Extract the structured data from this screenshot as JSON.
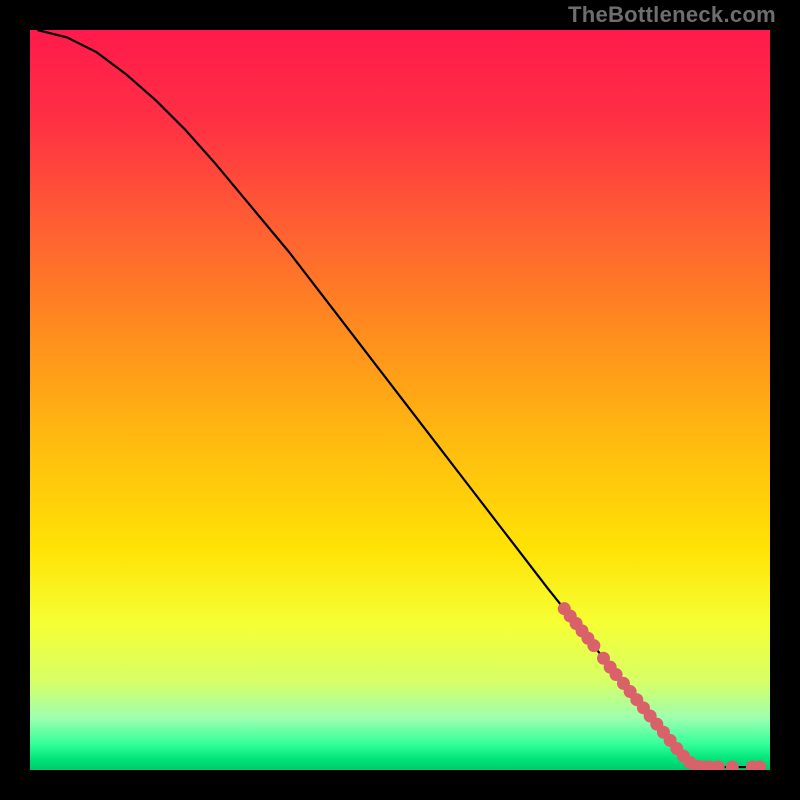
{
  "watermark": "TheBottleneck.com",
  "chart_data": {
    "type": "line",
    "title": "",
    "xlabel": "",
    "ylabel": "",
    "xlim": [
      0,
      100
    ],
    "ylim": [
      0,
      100
    ],
    "grid": false,
    "gradient_stops": [
      {
        "offset": 0.0,
        "color": "#ff1a4b"
      },
      {
        "offset": 0.12,
        "color": "#ff2f44"
      },
      {
        "offset": 0.25,
        "color": "#ff5a35"
      },
      {
        "offset": 0.4,
        "color": "#ff8a1f"
      },
      {
        "offset": 0.55,
        "color": "#ffb910"
      },
      {
        "offset": 0.7,
        "color": "#ffe205"
      },
      {
        "offset": 0.8,
        "color": "#f6ff33"
      },
      {
        "offset": 0.88,
        "color": "#d7ff66"
      },
      {
        "offset": 0.93,
        "color": "#9dffb0"
      },
      {
        "offset": 0.965,
        "color": "#33ff99"
      },
      {
        "offset": 0.985,
        "color": "#00e57a"
      },
      {
        "offset": 1.0,
        "color": "#00c96a"
      }
    ],
    "series": [
      {
        "name": "curve",
        "type": "line",
        "color": "#000000",
        "width": 2.2,
        "points": [
          {
            "x": 1,
            "y": 100
          },
          {
            "x": 5,
            "y": 99
          },
          {
            "x": 9,
            "y": 97
          },
          {
            "x": 13,
            "y": 94
          },
          {
            "x": 17,
            "y": 90.5
          },
          {
            "x": 21,
            "y": 86.5
          },
          {
            "x": 25,
            "y": 82
          },
          {
            "x": 30,
            "y": 76
          },
          {
            "x": 35,
            "y": 70
          },
          {
            "x": 40,
            "y": 63.5
          },
          {
            "x": 45,
            "y": 57
          },
          {
            "x": 50,
            "y": 50.5
          },
          {
            "x": 55,
            "y": 44
          },
          {
            "x": 60,
            "y": 37.5
          },
          {
            "x": 65,
            "y": 31
          },
          {
            "x": 70,
            "y": 24.5
          },
          {
            "x": 74,
            "y": 19.5
          },
          {
            "x": 78,
            "y": 14.5
          },
          {
            "x": 82,
            "y": 9.5
          },
          {
            "x": 85,
            "y": 5.7
          },
          {
            "x": 87.5,
            "y": 3.0
          },
          {
            "x": 89.5,
            "y": 1.2
          },
          {
            "x": 91,
            "y": 0.5
          },
          {
            "x": 93,
            "y": 0.4
          },
          {
            "x": 95,
            "y": 0.4
          },
          {
            "x": 97,
            "y": 0.4
          },
          {
            "x": 99,
            "y": 0.4
          }
        ]
      },
      {
        "name": "dots",
        "type": "scatter",
        "color": "#d9616a",
        "radius": 6.5,
        "points": [
          {
            "x": 72.2,
            "y": 21.8
          },
          {
            "x": 73.0,
            "y": 20.8
          },
          {
            "x": 73.8,
            "y": 19.8
          },
          {
            "x": 74.6,
            "y": 18.8
          },
          {
            "x": 75.4,
            "y": 17.8
          },
          {
            "x": 76.2,
            "y": 16.8
          },
          {
            "x": 77.5,
            "y": 15.1
          },
          {
            "x": 78.4,
            "y": 13.9
          },
          {
            "x": 79.2,
            "y": 12.9
          },
          {
            "x": 80.2,
            "y": 11.7
          },
          {
            "x": 81.1,
            "y": 10.6
          },
          {
            "x": 82.0,
            "y": 9.5
          },
          {
            "x": 82.9,
            "y": 8.4
          },
          {
            "x": 83.8,
            "y": 7.3
          },
          {
            "x": 84.7,
            "y": 6.2
          },
          {
            "x": 85.6,
            "y": 5.1
          },
          {
            "x": 86.5,
            "y": 4.0
          },
          {
            "x": 87.4,
            "y": 2.9
          },
          {
            "x": 88.3,
            "y": 1.9
          },
          {
            "x": 89.2,
            "y": 1.0
          },
          {
            "x": 90.2,
            "y": 0.5
          },
          {
            "x": 91.0,
            "y": 0.4
          },
          {
            "x": 91.9,
            "y": 0.4
          },
          {
            "x": 93.0,
            "y": 0.4
          },
          {
            "x": 94.9,
            "y": 0.4
          },
          {
            "x": 97.6,
            "y": 0.4
          },
          {
            "x": 98.6,
            "y": 0.4
          }
        ]
      }
    ]
  }
}
